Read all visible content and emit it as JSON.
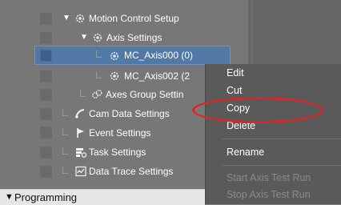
{
  "tree": {
    "motion_control_setup": "Motion Control Setup",
    "axis_settings": "Axis Settings",
    "axis_000": "MC_Axis000 (0)",
    "axis_002": "MC_Axis002 (2",
    "axes_group_settings": "Axes Group Settin",
    "cam_data_settings": "Cam Data Settings",
    "event_settings": "Event Settings",
    "task_settings": "Task Settings",
    "data_trace_settings": "Data Trace Settings"
  },
  "programming": {
    "label": "Programming"
  },
  "context_menu": {
    "edit": "Edit",
    "cut": "Cut",
    "copy": "Copy",
    "delete": "Delete",
    "rename": "Rename",
    "start_axis_test_run": "Start Axis Test Run",
    "stop_axis_test_run": "Stop Axis Test Run"
  },
  "icons": {
    "expand": "triangle-down-icon",
    "gear": "gear-icon",
    "cam": "cam-data-icon",
    "event": "flag-icon",
    "task": "task-icon",
    "trace": "data-trace-icon"
  },
  "colors": {
    "selection": "#5278a6",
    "highlight_oval": "#d42a2a",
    "menu_bg": "#5a5a5a"
  }
}
